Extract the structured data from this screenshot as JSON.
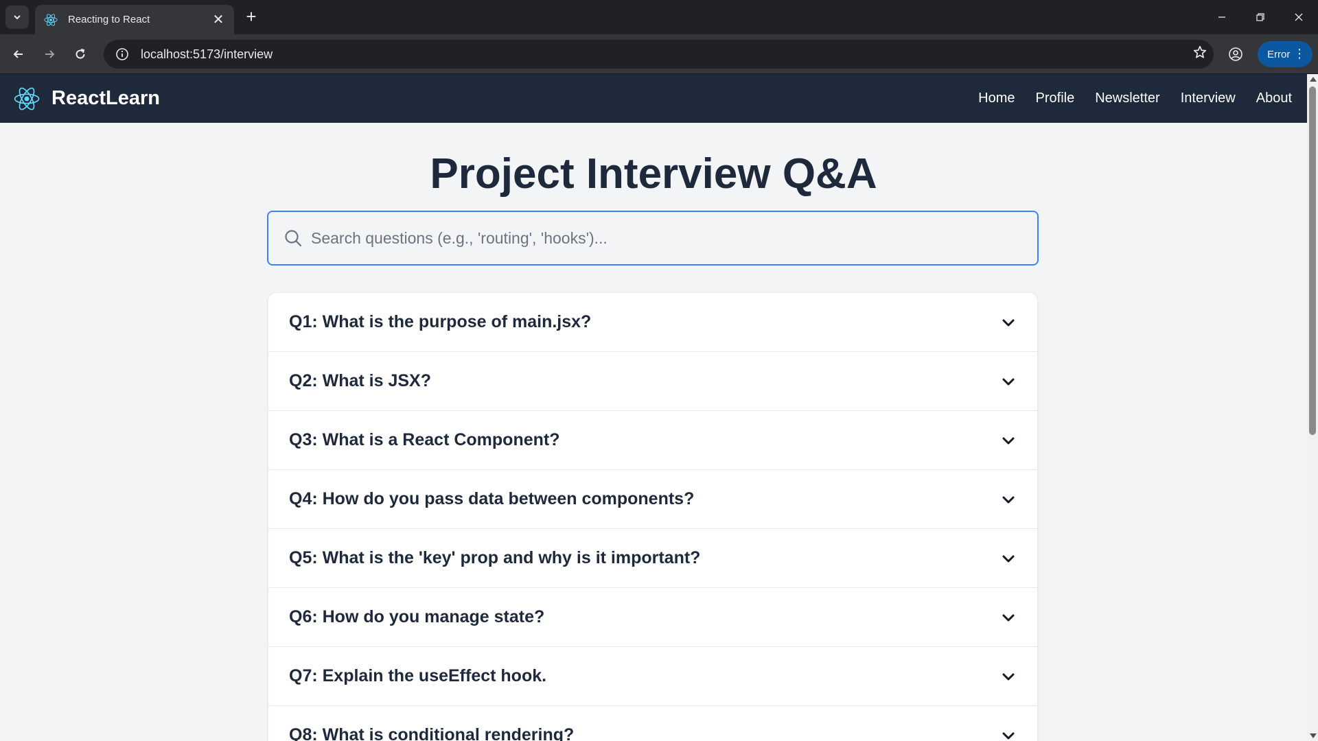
{
  "browser": {
    "tab_title": "Reacting to React",
    "url": "localhost:5173/interview",
    "error_label": "Error",
    "icons": {
      "tab_search": "chevron-down-icon",
      "tab_close": "close-icon",
      "new_tab": "plus-icon",
      "back": "arrow-left-icon",
      "forward": "arrow-right-icon",
      "reload": "reload-icon",
      "site_info": "info-icon",
      "bookmark": "star-icon",
      "profile": "profile-icon",
      "menu": "more-vert-icon"
    }
  },
  "site": {
    "brand": "ReactLearn",
    "brand_color": "#61dafb",
    "nav_bg": "#1e293b",
    "nav_links": [
      "Home",
      "Profile",
      "Newsletter",
      "Interview",
      "About"
    ]
  },
  "main": {
    "title": "Project Interview Q&A",
    "search_placeholder": "Search questions (e.g., 'routing', 'hooks')...",
    "search_value": "",
    "accent_color": "#3b82f6",
    "questions": [
      "Q1: What is the purpose of main.jsx?",
      "Q2: What is JSX?",
      "Q3: What is a React Component?",
      "Q4: How do you pass data between components?",
      "Q5: What is the 'key' prop and why is it important?",
      "Q6: How do you manage state?",
      "Q7: Explain the useEffect hook.",
      "Q8: What is conditional rendering?"
    ]
  }
}
